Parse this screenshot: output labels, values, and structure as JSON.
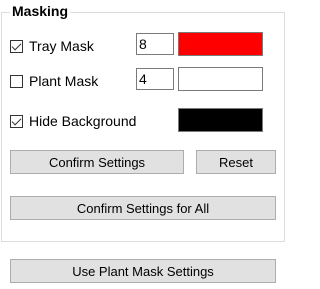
{
  "masking": {
    "title": "Masking",
    "tray_mask": {
      "label": "Tray Mask",
      "checked": true,
      "value": "8",
      "color": "#ff0000"
    },
    "plant_mask": {
      "label": "Plant Mask",
      "checked": false,
      "value": "4",
      "color": "#ffffff"
    },
    "hide_background": {
      "label": "Hide Background",
      "checked": true,
      "color": "#000000"
    },
    "buttons": {
      "confirm": "Confirm Settings",
      "reset": "Reset",
      "confirm_all": "Confirm Settings for All"
    }
  },
  "use_plant_mask_button": "Use Plant Mask Settings",
  "icons": {
    "spin_up": "▲",
    "spin_down": "▼"
  }
}
